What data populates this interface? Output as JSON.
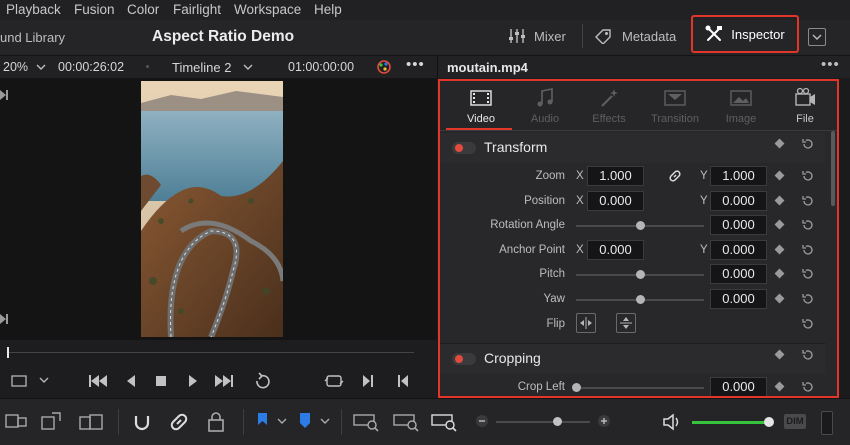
{
  "menu": [
    "Playback",
    "Fusion",
    "Color",
    "Fairlight",
    "Workspace",
    "Help"
  ],
  "header": {
    "sound_library": "und Library",
    "project_title": "Aspect Ratio Demo",
    "mixer": "Mixer",
    "metadata": "Metadata",
    "inspector": "Inspector"
  },
  "viewer": {
    "zoom": "20%",
    "source_timecode": "00:00:26:02",
    "timeline": "Timeline 2",
    "record_timecode": "01:00:00:00"
  },
  "inspector": {
    "clip_name": "moutain.mp4",
    "tabs": [
      {
        "label": "Video",
        "icon": "film-icon",
        "active": true
      },
      {
        "label": "Audio",
        "icon": "music-note-icon",
        "active": false
      },
      {
        "label": "Effects",
        "icon": "magic-wand-icon",
        "active": false
      },
      {
        "label": "Transition",
        "icon": "transition-icon",
        "active": false
      },
      {
        "label": "Image",
        "icon": "image-icon",
        "active": false
      },
      {
        "label": "File",
        "icon": "film-reel-icon",
        "active": false
      }
    ],
    "transform": {
      "title": "Transform",
      "zoom": {
        "label": "Zoom",
        "x_label": "X",
        "x": "1.000",
        "y_label": "Y",
        "y": "1.000"
      },
      "position": {
        "label": "Position",
        "x_label": "X",
        "x": "0.000",
        "y_label": "Y",
        "y": "0.000"
      },
      "rotation_angle": {
        "label": "Rotation Angle",
        "value": "0.000"
      },
      "anchor_point": {
        "label": "Anchor Point",
        "x_label": "X",
        "x": "0.000",
        "y_label": "Y",
        "y": "0.000"
      },
      "pitch": {
        "label": "Pitch",
        "value": "0.000"
      },
      "yaw": {
        "label": "Yaw",
        "value": "0.000"
      },
      "flip": {
        "label": "Flip"
      }
    },
    "cropping": {
      "title": "Cropping",
      "crop_left": {
        "label": "Crop Left",
        "value": "0.000"
      }
    }
  },
  "bottombar": {
    "dim_label": "DIM"
  },
  "colors": {
    "highlight": "#e3362b",
    "accent_red": "#e24b3c",
    "timeline_blue": "#2d7be5",
    "volume_green": "#35c43c"
  }
}
